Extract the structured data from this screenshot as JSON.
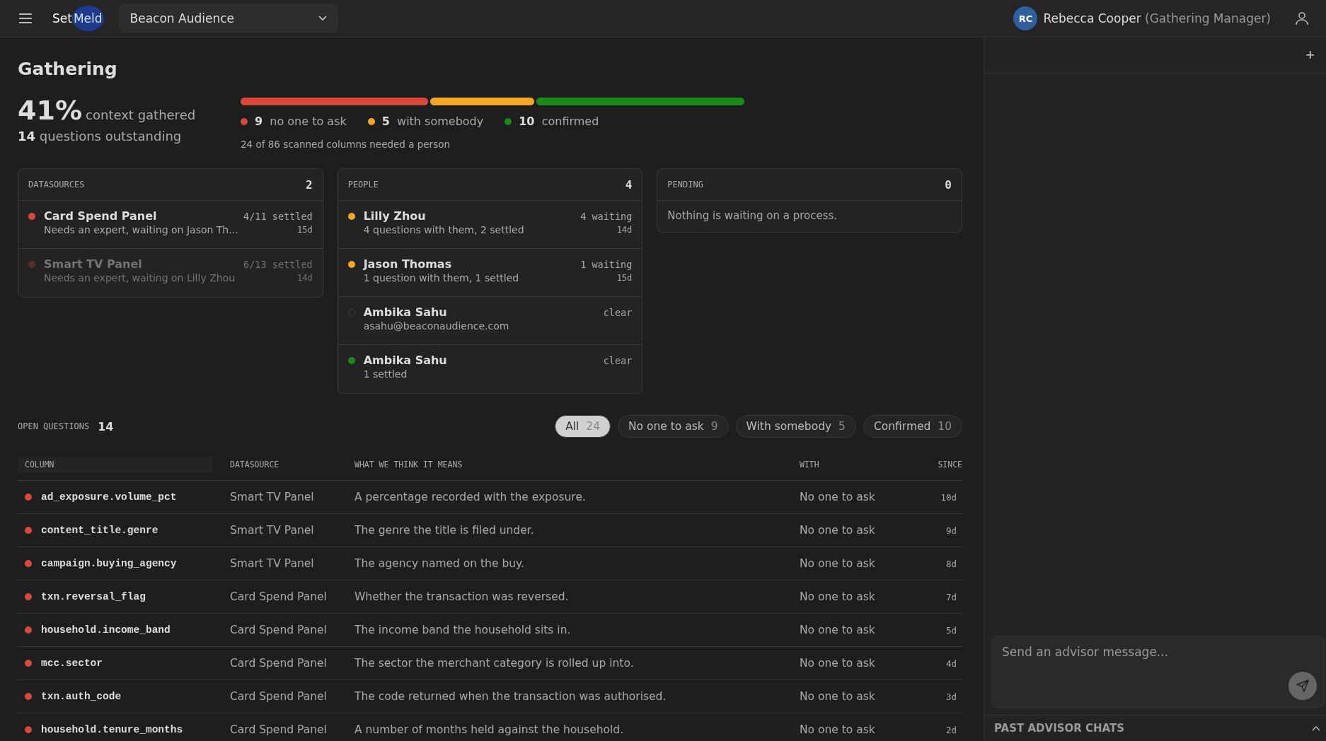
{
  "topbar": {
    "logo_a": "Set",
    "logo_b": "Meld",
    "workspace": "Beacon Audience",
    "user_initials": "RC",
    "user_name": "Rebecca Cooper",
    "user_role": "(Gathering Manager)"
  },
  "summary": {
    "title": "Gathering",
    "percent": "41%",
    "percent_label": "context gathered",
    "outstanding_count": "14",
    "outstanding_label": "questions outstanding",
    "segments": [
      {
        "count": "9",
        "label": "no one to ask",
        "color": "#d9483b"
      },
      {
        "count": "5",
        "label": "with somebody",
        "color": "#f5a623"
      },
      {
        "count": "10",
        "label": "confirmed",
        "color": "#1a8a1a"
      }
    ],
    "note": "24 of 86 scanned columns needed a person"
  },
  "datasources": {
    "title": "DATASOURCES",
    "count": "2",
    "items": [
      {
        "name": "Card Spend Panel",
        "detail": "Needs an expert, waiting on Jason Th...",
        "status": "4/11 settled",
        "age": "15d",
        "color": "#d9483b",
        "muted": false
      },
      {
        "name": "Smart TV Panel",
        "detail": "Needs an expert, waiting on Lilly Zhou",
        "status": "6/13 settled",
        "age": "14d",
        "color": "#5c2e2a",
        "muted": true
      }
    ]
  },
  "people": {
    "title": "PEOPLE",
    "count": "4",
    "items": [
      {
        "name": "Lilly Zhou",
        "detail": "4 questions with them, 2 settled",
        "status": "4 waiting",
        "age": "14d",
        "kind": "dot",
        "color": "#f5a623"
      },
      {
        "name": "Jason Thomas",
        "detail": "1 question with them, 1 settled",
        "status": "1 waiting",
        "age": "15d",
        "kind": "dot",
        "color": "#f5a623"
      },
      {
        "name": "Ambika Sahu",
        "detail": "asahu@beaconaudience.com",
        "status": "clear",
        "kind": "ring",
        "color": "#444444"
      },
      {
        "name": "Ambika Sahu",
        "detail": "1 settled",
        "status": "clear",
        "kind": "dot",
        "color": "#1a8a1a"
      }
    ]
  },
  "pending": {
    "title": "PENDING",
    "count": "0",
    "message": "Nothing is waiting on a process."
  },
  "questions": {
    "title": "OPEN QUESTIONS",
    "count": "14",
    "filters": [
      {
        "label": "All",
        "count": "24",
        "selected": true
      },
      {
        "label": "No one to ask",
        "count": "9",
        "selected": false
      },
      {
        "label": "With somebody",
        "count": "5",
        "selected": false
      },
      {
        "label": "Confirmed",
        "count": "10",
        "selected": false
      }
    ],
    "columns": [
      "COLUMN",
      "DATASOURCE",
      "WHAT WE THINK IT MEANS",
      "WITH",
      "SINCE"
    ],
    "rows": [
      {
        "column": "ad_exposure.volume_pct",
        "datasource": "Smart TV Panel",
        "meaning": "A percentage recorded with the exposure.",
        "with": "No one to ask",
        "since": "10d",
        "color": "#d9483b"
      },
      {
        "column": "content_title.genre",
        "datasource": "Smart TV Panel",
        "meaning": "The genre the title is filed under.",
        "with": "No one to ask",
        "since": "9d",
        "color": "#d9483b"
      },
      {
        "column": "campaign.buying_agency",
        "datasource": "Smart TV Panel",
        "meaning": "The agency named on the buy.",
        "with": "No one to ask",
        "since": "8d",
        "color": "#d9483b"
      },
      {
        "column": "txn.reversal_flag",
        "datasource": "Card Spend Panel",
        "meaning": "Whether the transaction was reversed.",
        "with": "No one to ask",
        "since": "7d",
        "color": "#d9483b"
      },
      {
        "column": "household.income_band",
        "datasource": "Card Spend Panel",
        "meaning": "The income band the household sits in.",
        "with": "No one to ask",
        "since": "5d",
        "color": "#d9483b"
      },
      {
        "column": "mcc.sector",
        "datasource": "Card Spend Panel",
        "meaning": "The sector the merchant category is rolled up into.",
        "with": "No one to ask",
        "since": "4d",
        "color": "#d9483b"
      },
      {
        "column": "txn.auth_code",
        "datasource": "Card Spend Panel",
        "meaning": "The code returned when the transaction was authorised.",
        "with": "No one to ask",
        "since": "3d",
        "color": "#d9483b"
      },
      {
        "column": "household.tenure_months",
        "datasource": "Card Spend Panel",
        "meaning": "A number of months held against the household.",
        "with": "No one to ask",
        "since": "2d",
        "color": "#d9483b"
      }
    ]
  },
  "advisor": {
    "add": "+",
    "placeholder": "Send an advisor message...",
    "past_title": "PAST ADVISOR CHATS",
    "past_expanded": true
  }
}
